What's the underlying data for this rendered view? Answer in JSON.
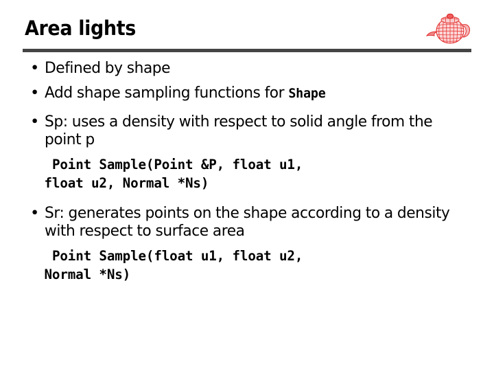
{
  "slide": {
    "title": "Area lights",
    "logo_icon": "teapot-wireframe-icon",
    "accent_color": "#e83434",
    "rule_color": "#454545",
    "text_color": "#000000",
    "background_color": "#ffffff",
    "bullets": [
      {
        "marker": "•",
        "text": "Defined by shape"
      },
      {
        "marker": "•",
        "text_before_code": "Add shape sampling functions for ",
        "inline_code": "Shape"
      },
      {
        "marker": "•",
        "text": "Sp: uses a density with respect to solid angle from the point p"
      },
      {
        "marker": "•",
        "text": "Sr: generates points on the shape according to a density with respect to surface area"
      }
    ],
    "code_blocks": [
      {
        "text": " Point Sample(Point &P, float u1,\nfloat u2, Normal *Ns)"
      },
      {
        "text": " Point Sample(float u1, float u2,\nNormal *Ns)"
      }
    ]
  }
}
